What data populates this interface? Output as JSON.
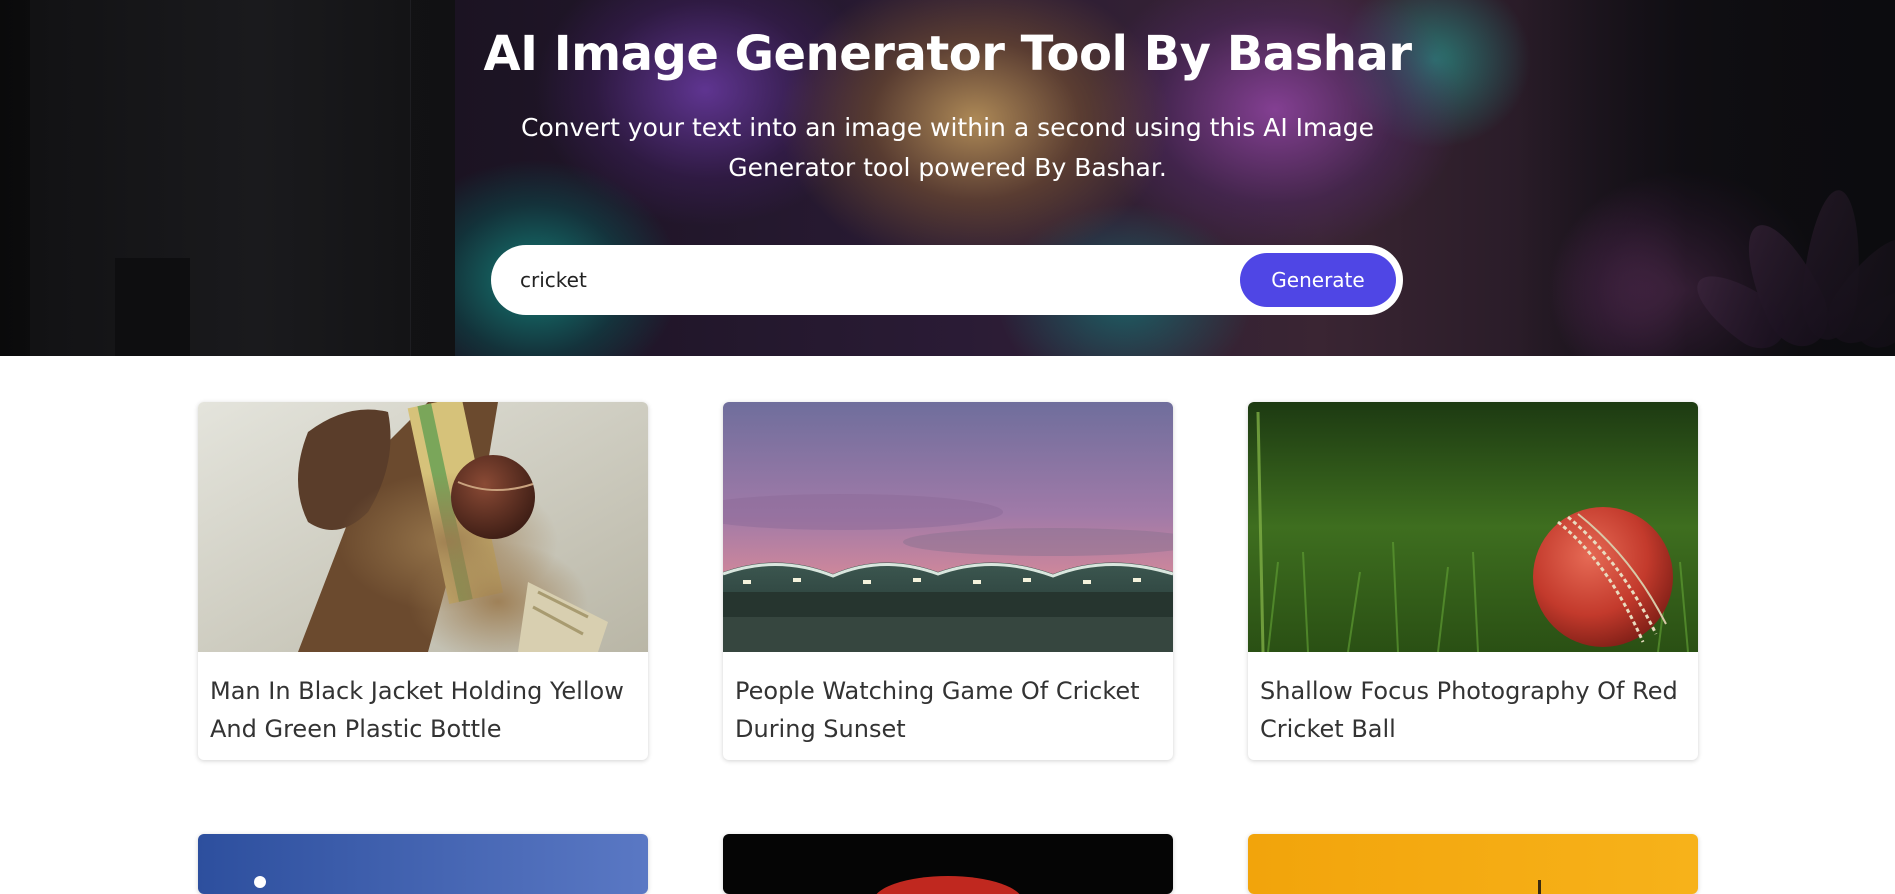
{
  "hero": {
    "title": "AI Image Generator Tool By Bashar",
    "subtitle": "Convert your text into an image within a second using this AI Image Generator tool powered By Bashar."
  },
  "search": {
    "value": "cricket",
    "placeholder": "",
    "button_label": "Generate",
    "button_color": "#4f46e5"
  },
  "gallery": {
    "cards": [
      {
        "caption": "Man In Black Jacket Holding Yellow And Green Plastic Bottle"
      },
      {
        "caption": "People Watching Game Of Cricket During Sunset"
      },
      {
        "caption": "Shallow Focus Photography Of Red Cricket Ball"
      }
    ]
  }
}
